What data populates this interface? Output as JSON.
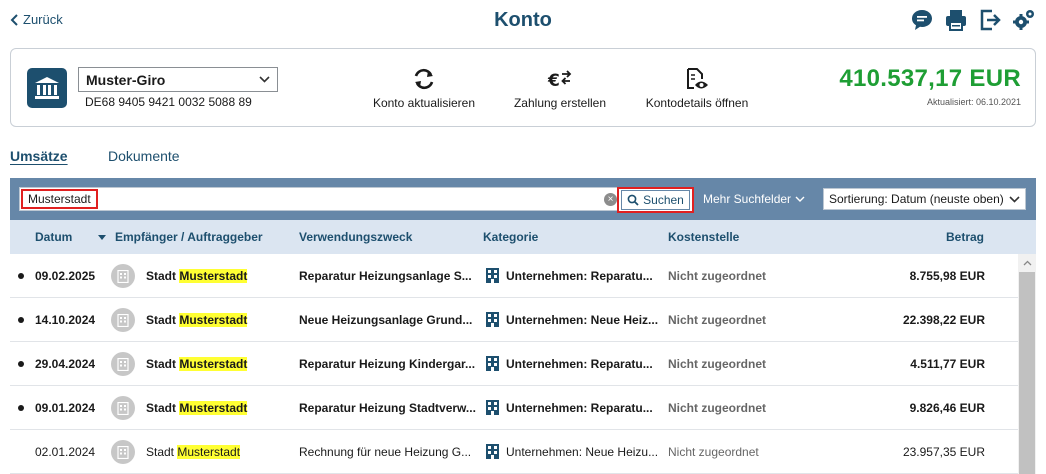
{
  "header": {
    "back_label": "Zurück",
    "title": "Konto",
    "icons": [
      "chat-icon",
      "print-icon",
      "logout-icon",
      "settings-icon"
    ]
  },
  "account": {
    "name": "Muster-Giro",
    "iban": "DE68 9405 9421 0032 5088 89",
    "actions": {
      "refresh": "Konto aktualisieren",
      "payment": "Zahlung erstellen",
      "details": "Kontodetails öffnen"
    },
    "balance": "410.537,17 EUR",
    "updated": "Aktualisiert: 06.10.2021"
  },
  "colors": {
    "brand": "#1d4f6e",
    "balance": "#1e9e34",
    "toolbar": "#6687a8",
    "highlight": "#ffff33",
    "table_header": "#dbe5f1"
  },
  "tabs": {
    "active": "Umsätze",
    "inactive": "Dokumente"
  },
  "search": {
    "value": "Musterstadt",
    "button_label": "Suchen",
    "more_fields": "Mehr Suchfelder",
    "sort_value": "Sortierung: Datum (neuste oben)"
  },
  "table": {
    "columns": {
      "date": "Datum",
      "party": "Empfänger / Auftraggeber",
      "purpose": "Verwendungszweck",
      "category": "Kategorie",
      "cost_center": "Kostenstelle",
      "amount": "Betrag"
    },
    "rows": [
      {
        "date": "09.02.2025",
        "party_prefix": "Stadt",
        "party_match": "Musterstadt",
        "purpose": "Reparatur Heizungsanlage S...",
        "category": "Unternehmen: Reparatu...",
        "cost_center": "Nicht zugeordnet",
        "amount": "8.755,98 EUR",
        "unread": true
      },
      {
        "date": "14.10.2024",
        "party_prefix": "Stadt",
        "party_match": "Musterstadt",
        "purpose": "Neue Heizungsanlage Grund...",
        "category": "Unternehmen: Neue Heiz...",
        "cost_center": "Nicht zugeordnet",
        "amount": "22.398,22 EUR",
        "unread": true
      },
      {
        "date": "29.04.2024",
        "party_prefix": "Stadt",
        "party_match": "Musterstadt",
        "purpose": "Reparatur Heizung Kindergar...",
        "category": "Unternehmen: Reparatu...",
        "cost_center": "Nicht zugeordnet",
        "amount": "4.511,77 EUR",
        "unread": true
      },
      {
        "date": "09.01.2024",
        "party_prefix": "Stadt",
        "party_match": "Musterstadt",
        "purpose": "Reparatur Heizung Stadtverw...",
        "category": "Unternehmen: Reparatu...",
        "cost_center": "Nicht zugeordnet",
        "amount": "9.826,46 EUR",
        "unread": true
      },
      {
        "date": "02.01.2024",
        "party_prefix": "Stadt",
        "party_match": "Musterstadt",
        "purpose": "Rechnung für neue Heizung G...",
        "category": "Unternehmen: Neue Heizu...",
        "cost_center": "Nicht zugeordnet",
        "amount": "23.957,35 EUR",
        "unread": false
      }
    ]
  }
}
